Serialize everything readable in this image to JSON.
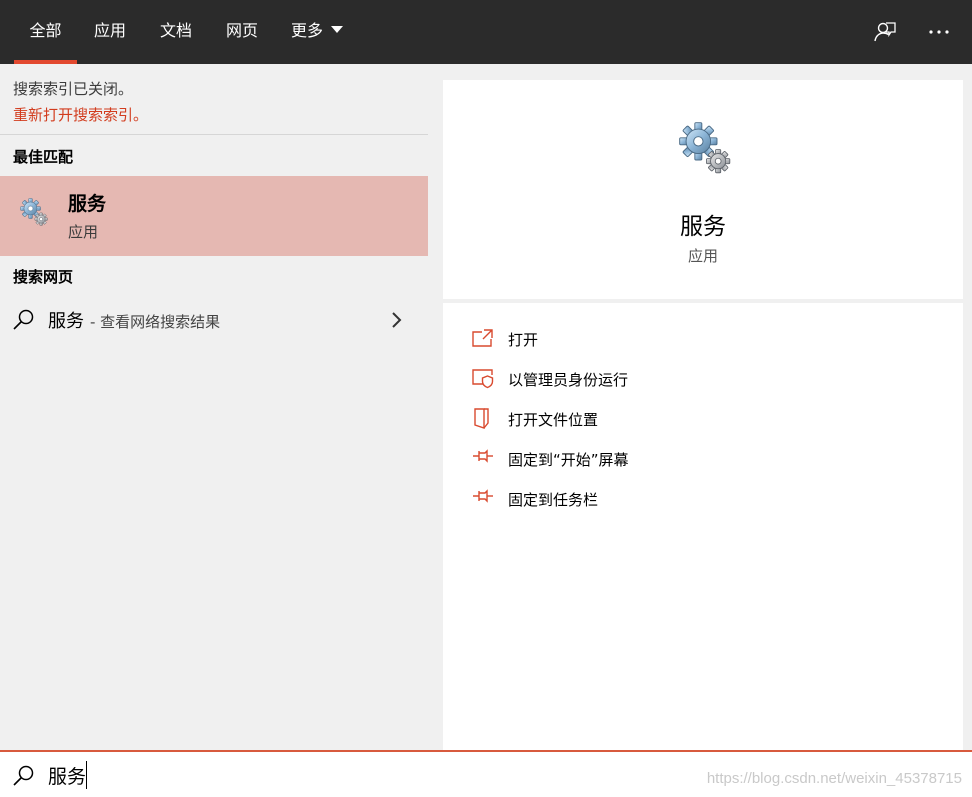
{
  "tabs": [
    {
      "label": "全部",
      "active": true
    },
    {
      "label": "应用"
    },
    {
      "label": "文档"
    },
    {
      "label": "网页"
    },
    {
      "label": "更多"
    }
  ],
  "top_icons": [
    "feedback-icon",
    "more-options-icon"
  ],
  "left": {
    "notice": "搜索索引已关闭。",
    "notice_link": "重新打开搜索索引。",
    "best_match_header": "最佳匹配",
    "best_match": {
      "name": "服务",
      "type": "应用",
      "icon": "gears-icon"
    },
    "web_header": "搜索网页",
    "web_result": {
      "query": "服务",
      "suffix": "- 查看网络搜索结果"
    }
  },
  "right": {
    "app_name": "服务",
    "app_type": "应用",
    "actions": [
      {
        "label": "打开",
        "icon": "open-icon"
      },
      {
        "label": "以管理员身份运行",
        "icon": "shield-admin-icon"
      },
      {
        "label": "打开文件位置",
        "icon": "file-location-icon"
      },
      {
        "label": "固定到“开始”屏幕",
        "icon": "pin-start-icon"
      },
      {
        "label": "固定到任务栏",
        "icon": "pin-taskbar-icon"
      }
    ]
  },
  "search": {
    "value": "服务"
  },
  "watermark": "https://blog.csdn.net/weixin_45378715",
  "colors": {
    "accent": "#e2492f",
    "selected_bg": "#e5b8b2",
    "topbar_bg": "#2b2b2b",
    "link_red": "#d23c1e"
  }
}
